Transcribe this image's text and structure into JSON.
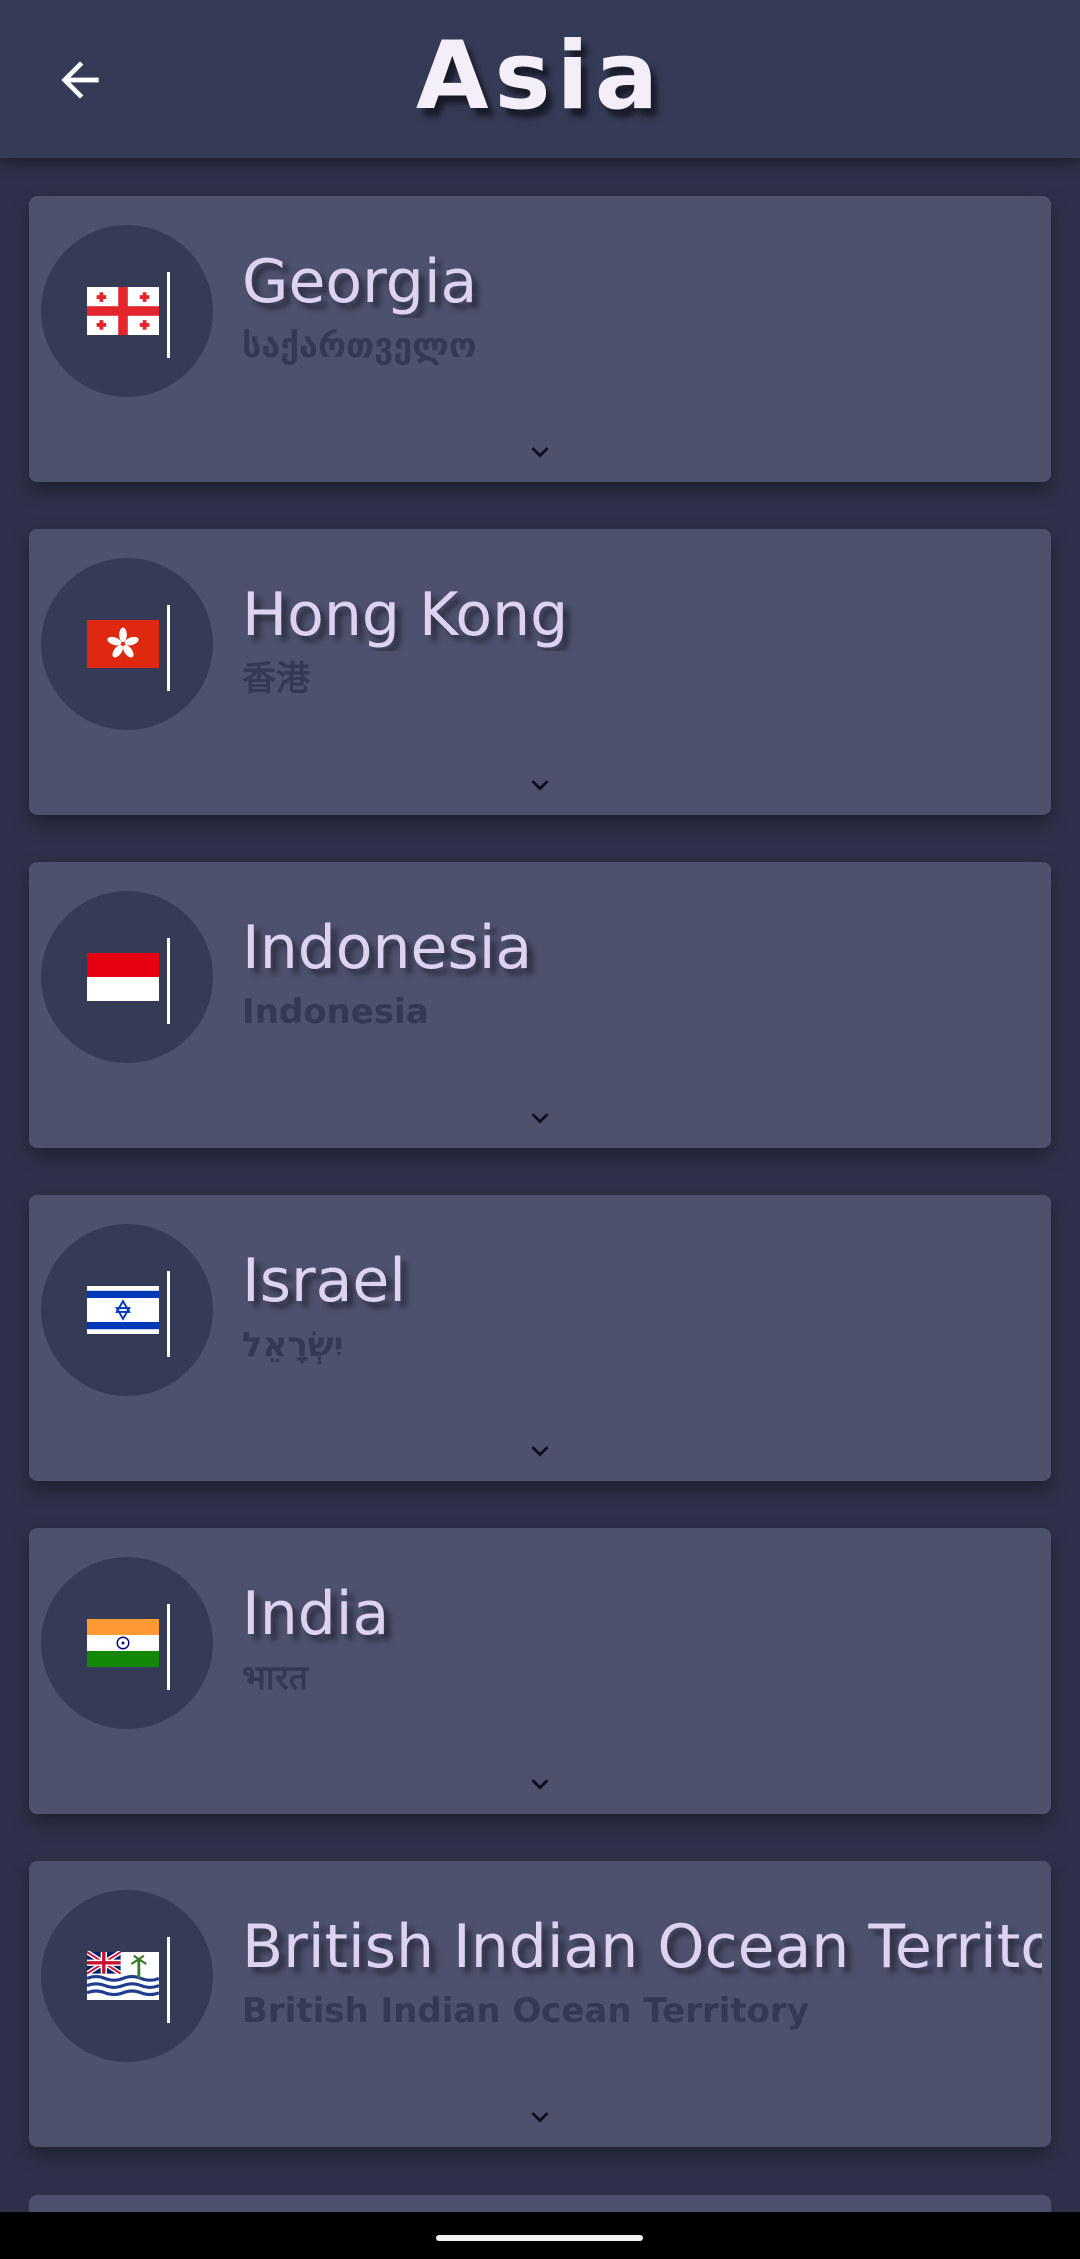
{
  "header": {
    "title": "Asia",
    "back_icon": "arrow-left-icon"
  },
  "countries": [
    {
      "name": "Georgia",
      "native": "საქართველო",
      "flag": "georgia-flag-icon"
    },
    {
      "name": "Hong Kong",
      "native": "香港",
      "flag": "hong-kong-flag-icon"
    },
    {
      "name": "Indonesia",
      "native": "Indonesia",
      "flag": "indonesia-flag-icon"
    },
    {
      "name": "Israel",
      "native": "יִשְׂרָאֵל",
      "flag": "israel-flag-icon"
    },
    {
      "name": "India",
      "native": "भारत",
      "flag": "india-flag-icon"
    },
    {
      "name": "British Indian Ocean Territory",
      "native": "British Indian Ocean Territory",
      "flag": "british-indian-ocean-territory-flag-icon"
    }
  ],
  "colors": {
    "background": "#2e3149",
    "appbar": "#353a56",
    "card": "#4d516e",
    "title_text": "#f3eef8",
    "name_text": "#ddd3f1",
    "native_text": "#353853"
  }
}
